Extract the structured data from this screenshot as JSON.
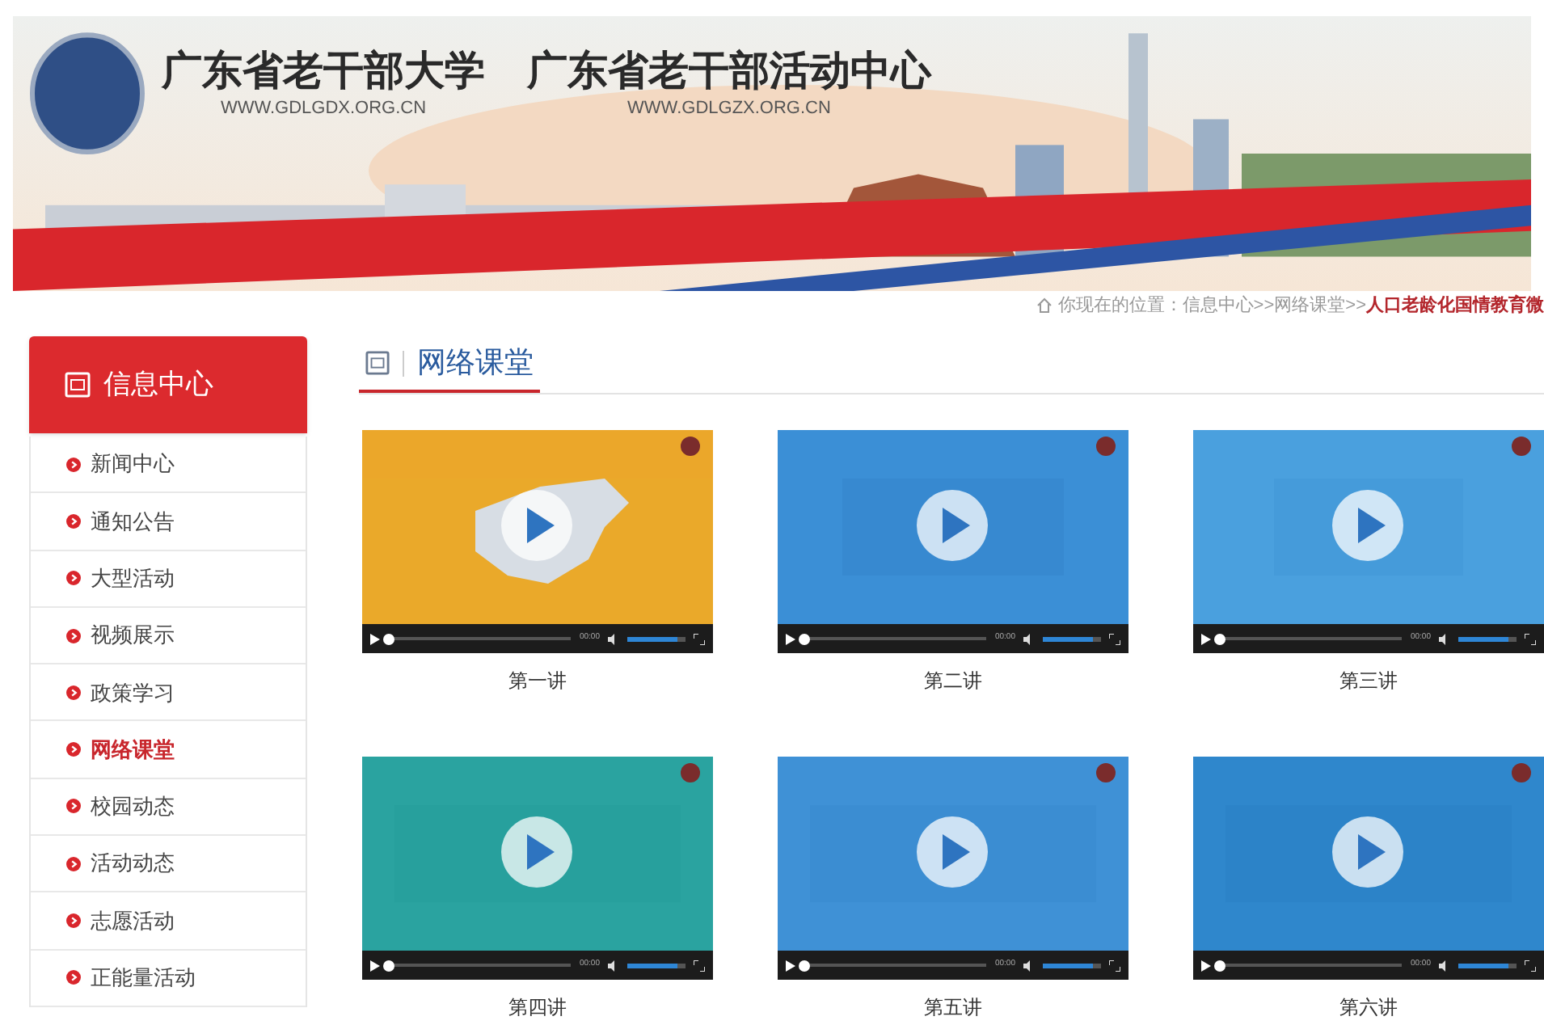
{
  "header": {
    "sites": [
      {
        "title": "广东省老干部大学",
        "url": "WWW.GDLGDX.ORG.CN"
      },
      {
        "title": "广东省老干部活动中心",
        "url": "WWW.GDLGZX.ORG.CN"
      }
    ]
  },
  "breadcrumb": [
    {
      "kind": "label",
      "label": "你现在的位置："
    },
    {
      "kind": "link",
      "label": "信息中心"
    },
    {
      "kind": "sep",
      "label": ">>"
    },
    {
      "kind": "link",
      "label": "网络课堂"
    },
    {
      "kind": "sep",
      "label": ">>"
    },
    {
      "kind": "current",
      "label": "人口老龄化国情教育微"
    }
  ],
  "sidebar": {
    "title": "信息中心",
    "items": [
      {
        "label": "新闻中心",
        "selected": false
      },
      {
        "label": "通知公告",
        "selected": false
      },
      {
        "label": "大型活动",
        "selected": false
      },
      {
        "label": "视频展示",
        "selected": false
      },
      {
        "label": "政策学习",
        "selected": false
      },
      {
        "label": "网络课堂",
        "selected": true
      },
      {
        "label": "校园动态",
        "selected": false
      },
      {
        "label": "活动动态",
        "selected": false
      },
      {
        "label": "志愿活动",
        "selected": false
      },
      {
        "label": "正能量活动",
        "selected": false
      }
    ]
  },
  "content": {
    "title": "网络课堂",
    "videos": [
      {
        "caption": "第一讲",
        "time": "00:00",
        "progress": {
          "level": 0
        },
        "volume": {
          "level": 0.85
        }
      },
      {
        "caption": "第二讲",
        "time": "00:00",
        "progress": {
          "level": 0
        },
        "volume": {
          "level": 0.85
        }
      },
      {
        "caption": "第三讲",
        "time": "00:00",
        "progress": {
          "level": 0
        },
        "volume": {
          "level": 0.85
        }
      },
      {
        "caption": "第四讲",
        "time": "00:00",
        "progress": {
          "level": 0
        },
        "volume": {
          "level": 0.85
        }
      },
      {
        "caption": "第五讲",
        "time": "00:00",
        "progress": {
          "level": 0
        },
        "volume": {
          "level": 0.85
        }
      },
      {
        "caption": "第六讲",
        "time": "00:00",
        "progress": {
          "level": 0
        },
        "volume": {
          "level": 0.85
        }
      }
    ]
  }
}
